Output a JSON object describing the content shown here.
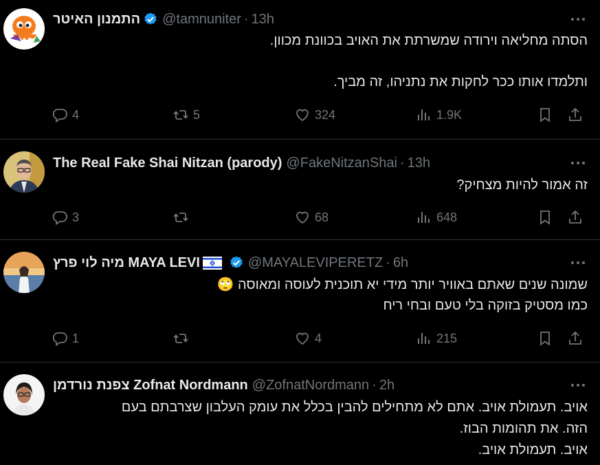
{
  "tweets": [
    {
      "name": "התמנון האיטר",
      "handle": "@tamnuniter",
      "time": "13h",
      "verified": true,
      "flag": false,
      "avatar_icon": "orange-octopus-avatar",
      "lines": [
        "הסתה מחליאה וירודה שמשרתת את האויב בכוונת מכוון.",
        "",
        "ותלמדו אותו ככר לחקות את נתניהו, זה מביך."
      ],
      "stats": {
        "replies": "4",
        "retweets": "5",
        "likes": "324",
        "views": "1.9K"
      }
    },
    {
      "name": "The Real Fake Shai Nitzan (parody)",
      "handle": "@FakeNitzanShai",
      "time": "13h",
      "verified": false,
      "flag": false,
      "avatar_icon": "man-glasses-avatar",
      "lines": [
        "זה אמור להיות מצחיק?"
      ],
      "stats": {
        "replies": "3",
        "retweets": "",
        "likes": "68",
        "views": "648"
      }
    },
    {
      "name": "מיה לוי פרץ MAYA LEVI",
      "handle": "@MAYALEVIPERETZ",
      "time": "6h",
      "verified": true,
      "flag": true,
      "avatar_icon": "woman-sunset-avatar",
      "lines": [
        "שמונה שנים שאתם באוויר יותר מידי יא תוכנית לעוסה ומאוסה 🙄",
        "כמו מסטיק בזוקה בלי טעם ובחי ריח"
      ],
      "stats": {
        "replies": "1",
        "retweets": "",
        "likes": "4",
        "views": "215"
      }
    },
    {
      "name": "צפנת נורדמן Zofnat Nordmann",
      "handle": "@ZofnatNordmann",
      "time": "2h",
      "verified": false,
      "flag": false,
      "avatar_icon": "woman-glasses-avatar",
      "lines": [
        "אויב. תעמולת אויב. אתם לא מתחילים להבין בכלל את עומק העלבון שצרבתם בעם",
        "הזה. את תהומות הבוז.",
        "אויב. תעמולת אויב."
      ],
      "stats": null
    }
  ],
  "colors": {
    "background": "#000000",
    "text": "#e7e9ea",
    "muted": "#71767b",
    "verified": "#1d9bf0",
    "divider": "#2f3336"
  }
}
